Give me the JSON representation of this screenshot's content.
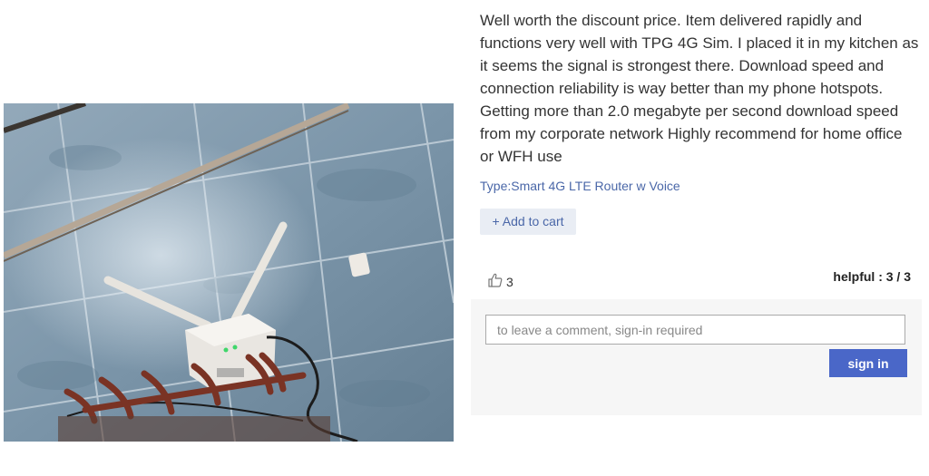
{
  "review": {
    "text": "Well worth the discount price. Item delivered rapidly and functions very well with TPG 4G Sim. I placed it in my kitchen as it seems the signal is strongest there. Download speed and connection reliability is way better than my phone hotspots. Getting more than 2.0 megabyte per second download speed from my corporate network Highly recommend for home office or WFH use",
    "variant": "Type:Smart 4G LTE Router w Voice",
    "add_to_cart_label": "+ Add to cart",
    "like_count": "3",
    "like_icon": "thumbs-up-icon",
    "helpful": "helpful : 3 / 3"
  },
  "comment": {
    "placeholder": "to leave a comment, sign-in required",
    "value": "",
    "signin_label": "sign in"
  },
  "colors": {
    "link": "#4a67a8",
    "signin_button": "#4a67c8",
    "add_cart_bg": "#e9edf4",
    "comment_panel_bg": "#f6f6f6"
  }
}
